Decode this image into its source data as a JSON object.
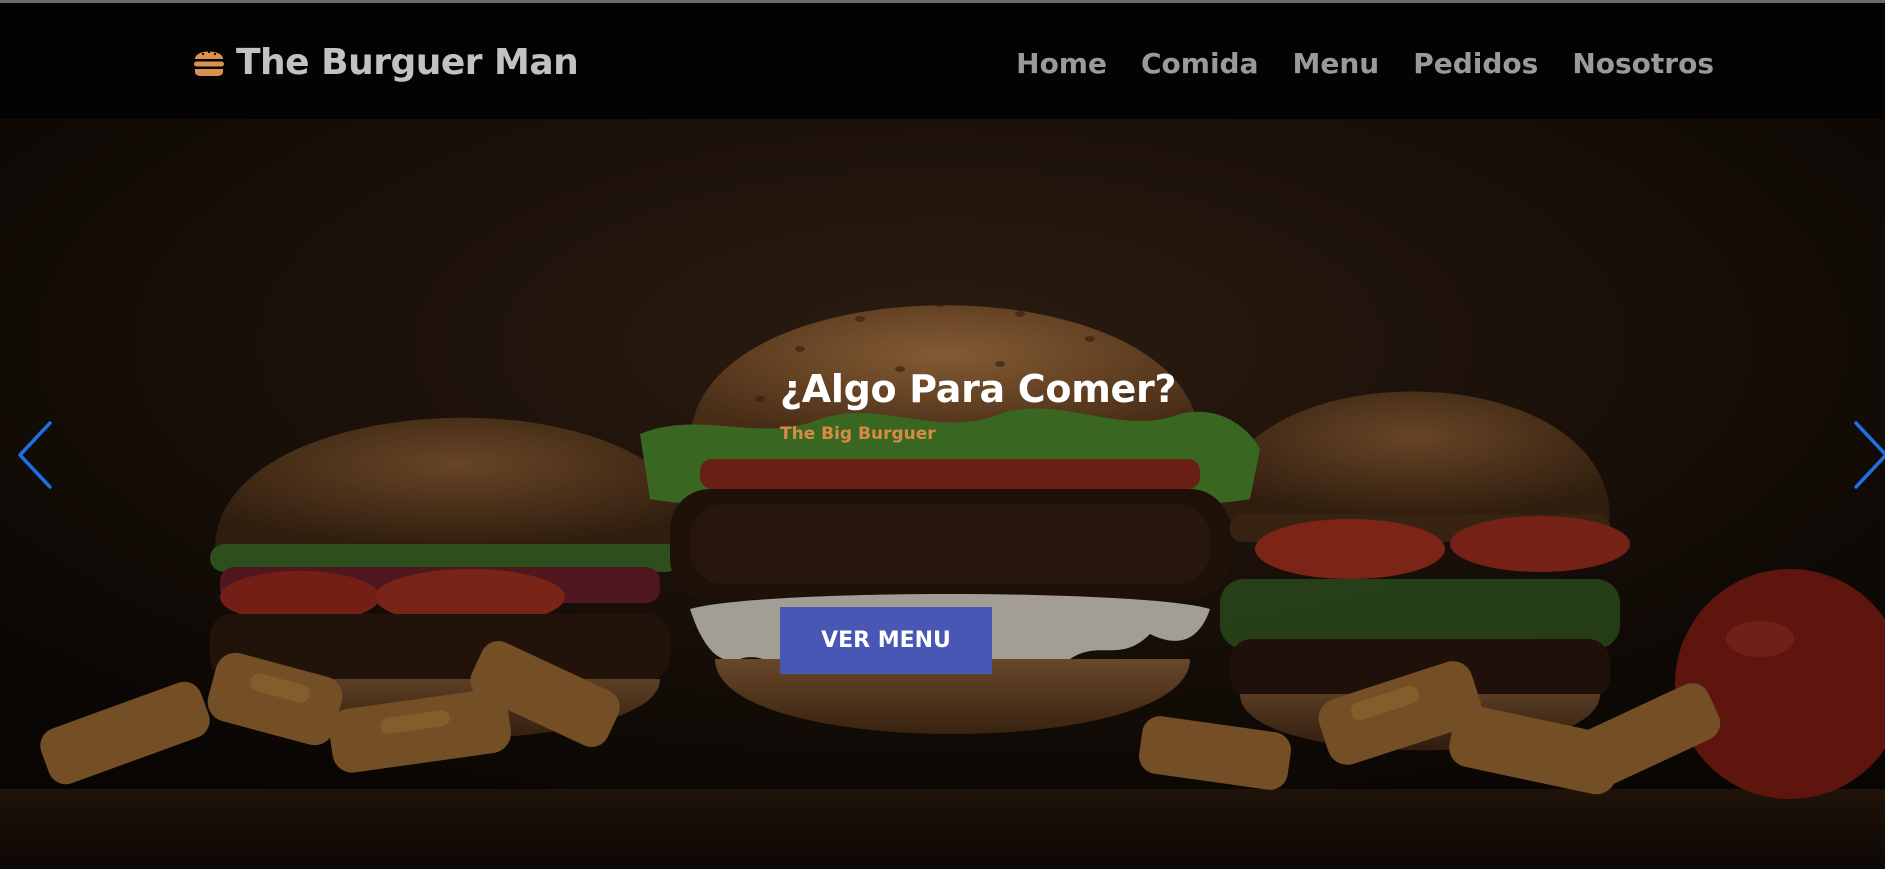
{
  "navbar": {
    "brand": {
      "icon": "burger-icon",
      "text": "The Burguer Man"
    },
    "links": [
      {
        "label": "Home"
      },
      {
        "label": "Comida"
      },
      {
        "label": "Menu"
      },
      {
        "label": "Pedidos"
      },
      {
        "label": "Nosotros"
      }
    ]
  },
  "hero": {
    "title": "¿Algo Para Comer?",
    "subtitle": "The Big Burguer",
    "cta_label": "VER MENU",
    "prev_icon": "chevron-left-icon",
    "next_icon": "chevron-right-icon"
  },
  "colors": {
    "navbar_bg": "#030303",
    "brand_icon": "#d9914f",
    "brand_text": "#c2c2c2",
    "nav_text": "#9a9a9a",
    "subtitle": "#d98a45",
    "cta_bg": "#4857b3",
    "arrow": "#1e6fe6"
  }
}
